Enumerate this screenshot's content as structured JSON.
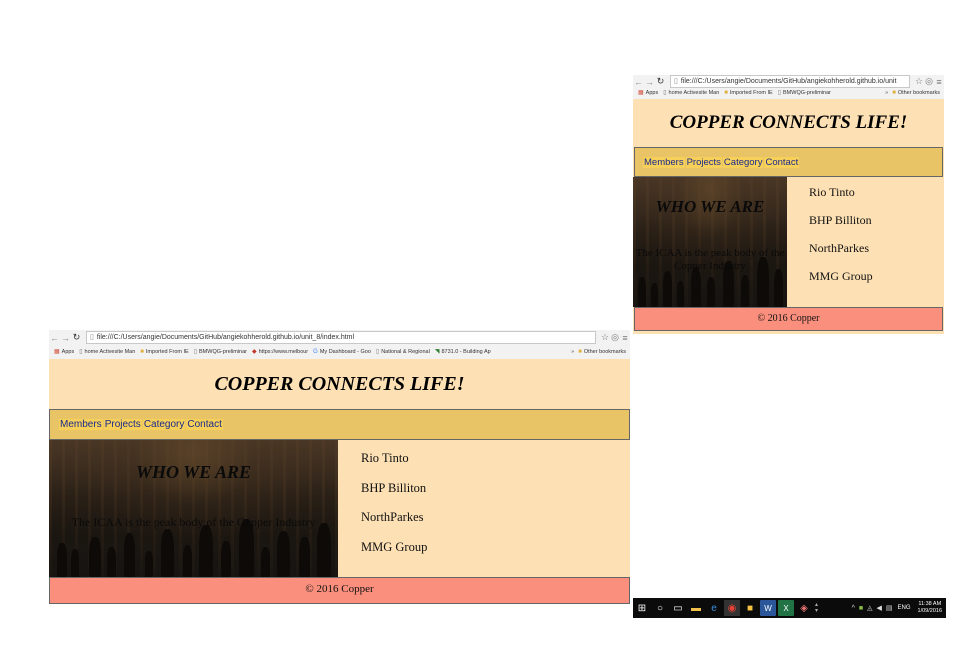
{
  "colors": {
    "page_background": "#fde0b4",
    "nav_background": "#e8c467",
    "nav_link_text": "#1a2a8c",
    "footer_background": "#fa8f7d",
    "taskbar_background": "#0b0b0b"
  },
  "large_window": {
    "address": "file:///C:/Users/angie/Documents/GitHub/angiekohherold.github.io/unit_8/index.html",
    "bookmarks": [
      {
        "label": "Apps",
        "icon": "apps-grid-icon"
      },
      {
        "label": "home Activesite Man",
        "icon": "page-icon"
      },
      {
        "label": "Imported From IE",
        "icon": "folder-icon"
      },
      {
        "label": "BMWQG-preliminar",
        "icon": "page-icon"
      },
      {
        "label": "https://www.melbour",
        "icon": "pin-icon"
      },
      {
        "label": "My Dashboard - Goo",
        "icon": "google-icon"
      },
      {
        "label": "National & Regional",
        "icon": "page-icon"
      },
      {
        "label": "8731.0 - Building Ap",
        "icon": "abs-icon"
      }
    ],
    "bookmarks_overflow": "»",
    "other_bookmarks": "Other bookmarks"
  },
  "small_window": {
    "address": "file:///C:/Users/angie/Documents/GitHub/angiekohherold.github.io/unit",
    "bookmarks": [
      {
        "label": "Apps",
        "icon": "apps-grid-icon"
      },
      {
        "label": "home Activesite Man",
        "icon": "page-icon"
      },
      {
        "label": "Imported From IE",
        "icon": "folder-icon"
      },
      {
        "label": "BMWQG-preliminar",
        "icon": "page-icon"
      }
    ],
    "bookmarks_overflow": "»",
    "other_bookmarks": "Other bookmarks"
  },
  "site": {
    "title": "COPPER CONNECTS LIFE!",
    "nav": [
      "Members",
      "Projects",
      "Category",
      "Contact"
    ],
    "hero_title": "WHO WE ARE",
    "hero_text": "The ICAA is the peak body of the Copper Industry",
    "members": [
      "Rio Tinto",
      "BHP Billiton",
      "NorthParkes",
      "MMG Group"
    ],
    "footer": "© 2016 Copper"
  },
  "taskbar": {
    "apps": [
      "file-explorer-icon",
      "edge-icon",
      "chrome-icon",
      "folder-icon",
      "word-icon",
      "excel-icon",
      "paint-icon"
    ],
    "language": "ENG",
    "time": "11:38 AM",
    "date": "1/09/2016"
  }
}
